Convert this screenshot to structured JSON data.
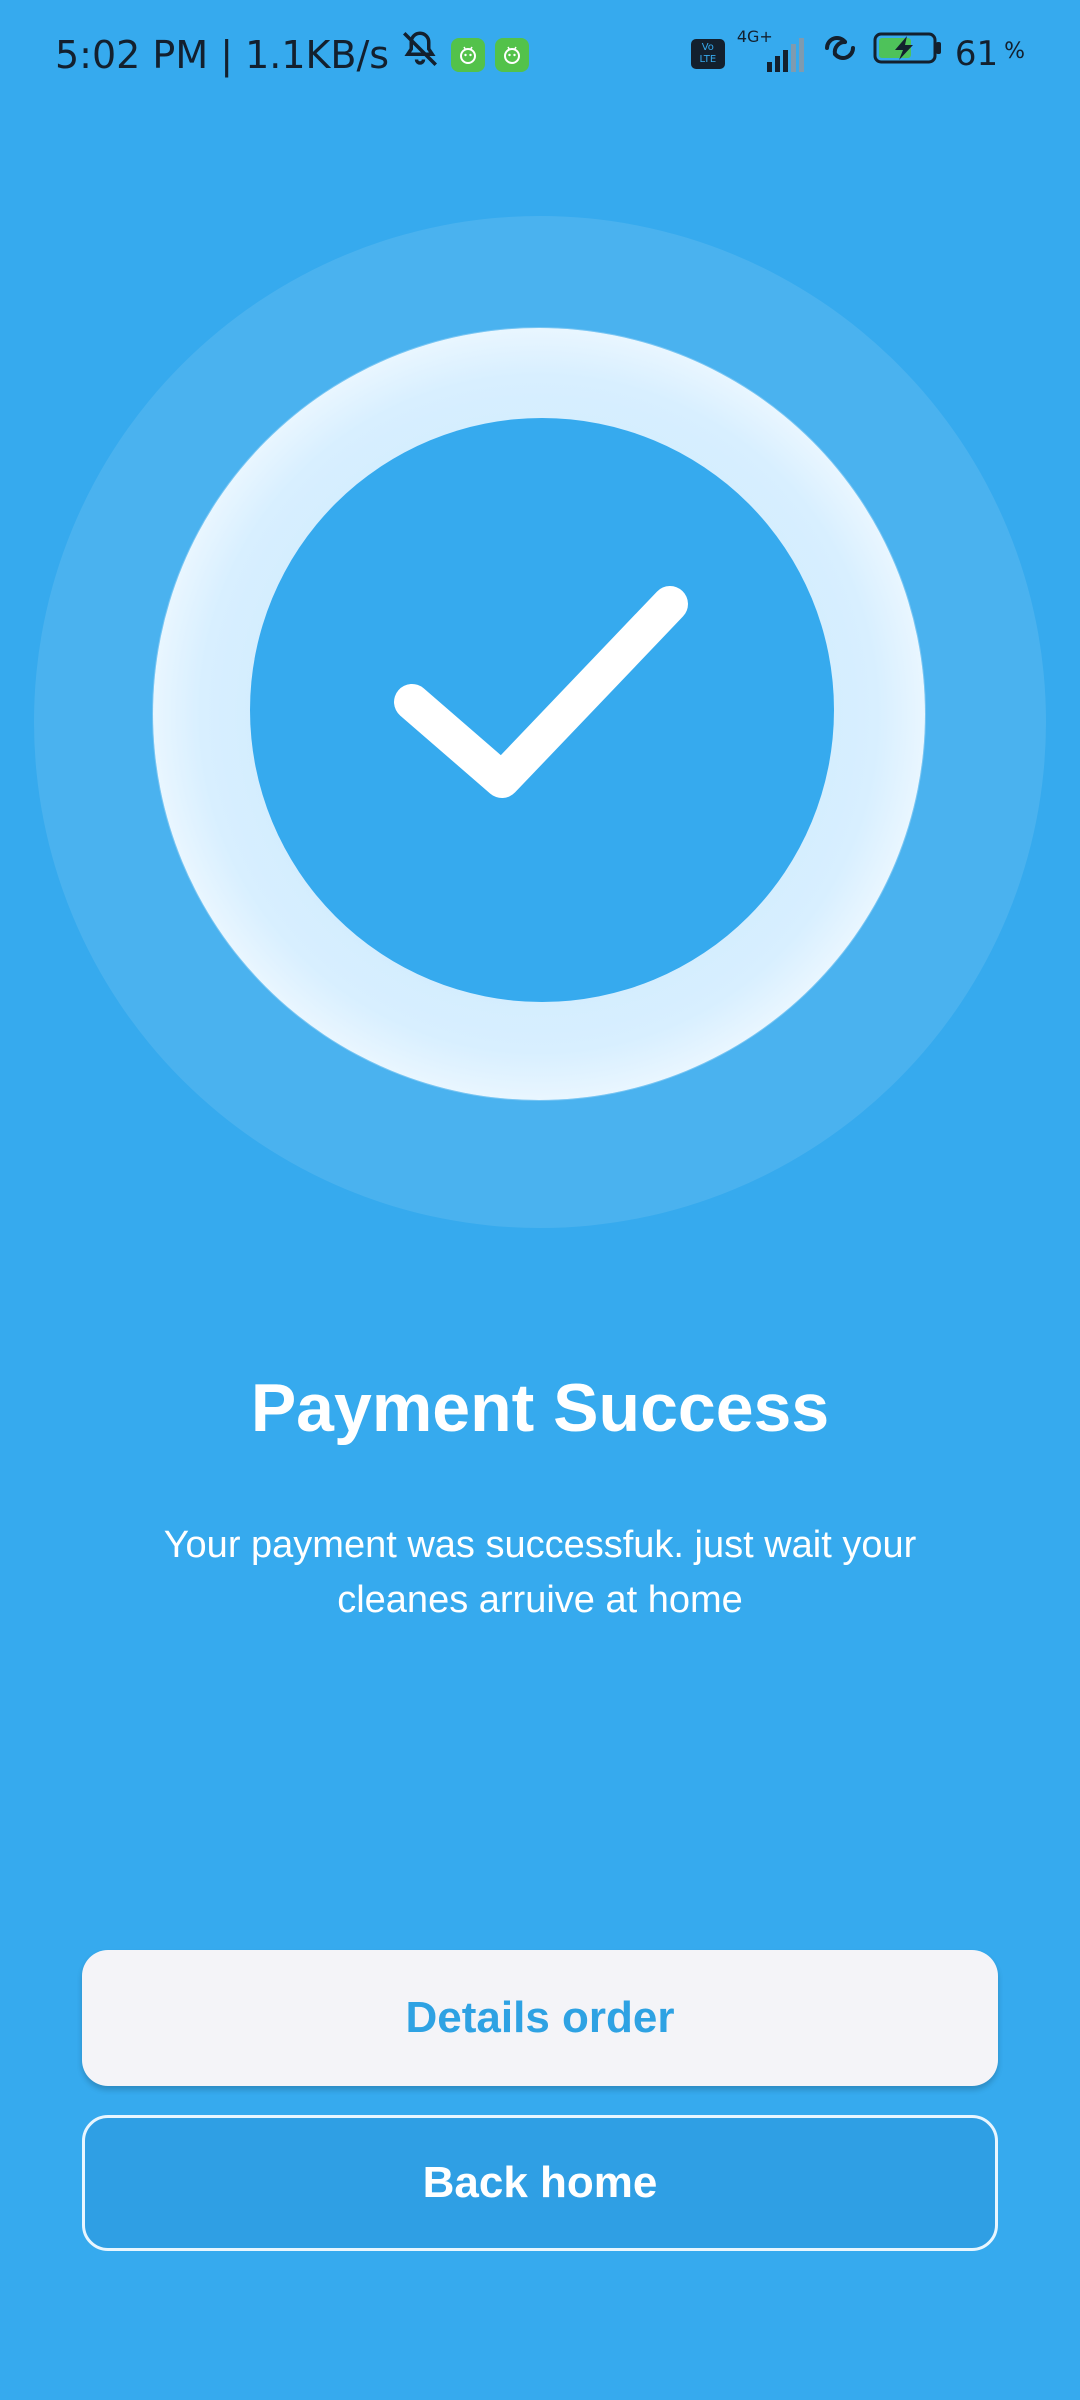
{
  "status_bar": {
    "time_and_speed": "5:02 PM | 1.1KB/s",
    "network_type": "4G+",
    "volte_label_top": "Vo",
    "volte_label_bottom": "LTE",
    "battery_value": "61",
    "battery_unit": "%"
  },
  "icons": {
    "mute": "bell-off-icon",
    "app_badge": "android-icon",
    "signal": "cellular-signal-icon",
    "hotspot": "link-icon",
    "battery": "battery-charging-icon",
    "hero": "checkmark-icon"
  },
  "content": {
    "title": "Payment Success",
    "message": "Your payment was successfuk. just wait your cleanes arruive at home"
  },
  "actions": {
    "details_label": "Details order",
    "home_label": "Back home"
  },
  "colors": {
    "background": "#36aaee",
    "primary_text": "#ffffff",
    "accent": "#2ea2e3",
    "button_light": "#f4f4f8"
  }
}
